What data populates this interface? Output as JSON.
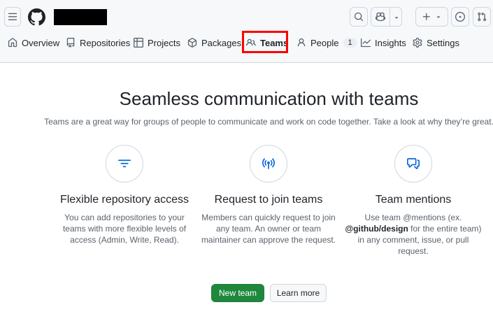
{
  "nav": {
    "tabs": [
      {
        "label": "Overview",
        "icon": "home-icon"
      },
      {
        "label": "Repositories",
        "icon": "repo-icon"
      },
      {
        "label": "Projects",
        "icon": "table-icon"
      },
      {
        "label": "Packages",
        "icon": "package-icon"
      },
      {
        "label": "Teams",
        "icon": "people-icon",
        "selected": true
      },
      {
        "label": "People",
        "icon": "person-icon",
        "count": "1"
      },
      {
        "label": "Insights",
        "icon": "graph-icon"
      },
      {
        "label": "Settings",
        "icon": "gear-icon"
      }
    ]
  },
  "main": {
    "title": "Seamless communication with teams",
    "subtitle": "Teams are a great way for groups of people to communicate and work on code together. Take a look at why they’re great.",
    "features": [
      {
        "icon": "filter-icon",
        "title": "Flexible repository access",
        "text": "You can add repositories to your teams with more flexible levels of access (Admin, Write, Read)."
      },
      {
        "icon": "broadcast-icon",
        "title": "Request to join teams",
        "text": "Members can quickly request to join any team. An owner or team maintainer can approve the request."
      },
      {
        "icon": "comment-discussion-icon",
        "title": "Team mentions",
        "text_before": "Use team @mentions (ex.",
        "text_bold": "@github/design",
        "text_after": "for the entire team) in any comment, issue, or pull request."
      }
    ],
    "buttons": {
      "new_team": "New team",
      "learn_more": "Learn more"
    }
  },
  "colors": {
    "primary_button": "#1f883d",
    "highlight_box": "#ff0000",
    "accent_icon": "#0969da"
  }
}
